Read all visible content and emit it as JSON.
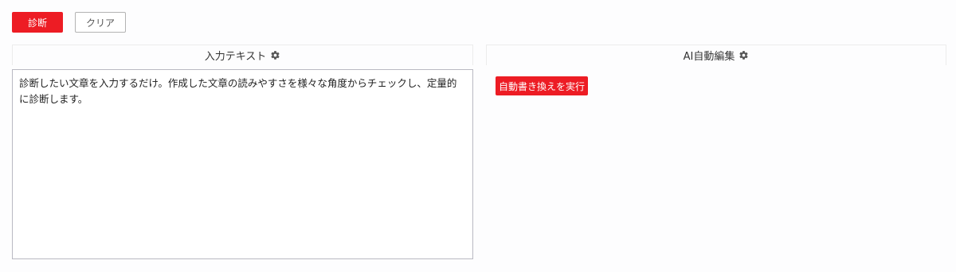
{
  "toolbar": {
    "diagnose_label": "診断",
    "clear_label": "クリア"
  },
  "left_panel": {
    "title": "入力テキスト",
    "text": "診断したい文章を入力するだけ。作成した文章の読みやすさを様々な角度からチェックし、定量的に診断します。"
  },
  "right_panel": {
    "title": "AI自動編集",
    "rewrite_label": "自動書き換えを実行"
  },
  "icons": {
    "settings": "gear-icon"
  },
  "colors": {
    "accent": "#ed1c24",
    "border": "#b9b9c2"
  }
}
